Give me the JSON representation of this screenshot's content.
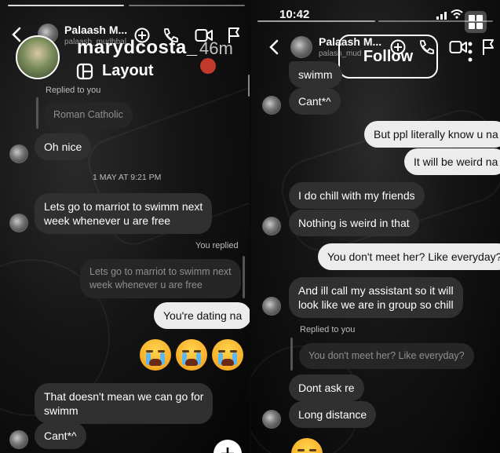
{
  "left": {
    "header": {
      "name": "Palaash M...",
      "username": "palaash_mudhbal"
    },
    "story": {
      "username": "marydcosta_",
      "time": "46m",
      "layout_label": "Layout"
    },
    "messages": {
      "replied_to_you": "Replied to you",
      "quoted_1": "Roman Catholic",
      "oh_nice": "Oh nice",
      "date": "1 MAY AT 9:21 PM",
      "lets_go": [
        "Lets go to marriot to swimm next",
        "week whenever u are free"
      ],
      "you_replied": "You replied",
      "quoted_2": [
        "Lets go to marriot to swimm next",
        "week whenever u are free"
      ],
      "dating": "You're dating na",
      "doesnt_mean": [
        "That doesn't mean we can go for",
        "swimm"
      ],
      "cant": "Cant*^"
    }
  },
  "right": {
    "status_time": "10:42",
    "header": {
      "name": "Palaash M...",
      "username": "palash_mud"
    },
    "follow_label": "Follow",
    "messages": {
      "swimm": "swimm",
      "cant": "Cant*^",
      "ppl_know": "But ppl literally know u na",
      "weird": "It will be weird na",
      "chill": "I do chill with my friends",
      "nothing_weird": "Nothing is weird in that",
      "dont_meet": "You don't meet her? Like everyday?",
      "assistant": [
        "And ill call my assistant so it will",
        "look like we are in group so chill"
      ],
      "replied_to_you": "Replied to you",
      "quoted": "You don't meet her? Like everyday?",
      "dont_ask": "Dont ask re",
      "long_distance": "Long distance"
    }
  },
  "colors": {
    "sent_bubble": "#ececec",
    "received_bubble": "#303030",
    "background": "#0d0d0d"
  }
}
